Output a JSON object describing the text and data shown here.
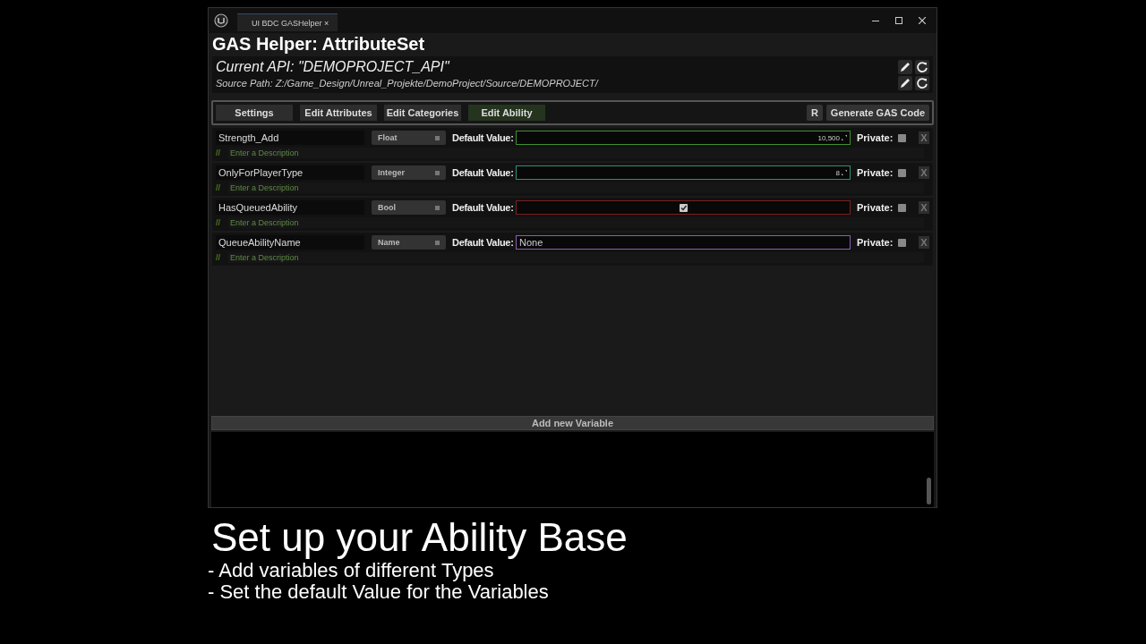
{
  "window": {
    "tab": "UI BDC GASHelper",
    "tab_close": "×"
  },
  "title": "GAS Helper: AttributeSet",
  "api": {
    "current": "Current API: \"DEMOPROJECT_API\"",
    "source_path": "Source Path: Z:/Game_Design/Unreal_Projekte/DemoProject/Source/DEMOPROJECT/"
  },
  "tabs": [
    {
      "label": "Settings",
      "selected": false
    },
    {
      "label": "Edit Attributes",
      "selected": false
    },
    {
      "label": "Edit Categories",
      "selected": false
    },
    {
      "label": "Edit Ability",
      "selected": true
    }
  ],
  "toolbar_buttons": [
    "R",
    "Generate GAS Code"
  ],
  "variables": [
    {
      "name": "Strength_Add",
      "type": "Float",
      "kind": "number",
      "color": "#3f8f2f",
      "default_label": "Default Value:",
      "value": "10,500",
      "private_label": "Private:",
      "private": false,
      "remove": "X",
      "description_mark": "//",
      "description_placeholder": "Enter a Description"
    },
    {
      "name": "OnlyForPlayerType",
      "type": "Integer",
      "kind": "number",
      "color": "#2f8f7a",
      "default_label": "Default Value:",
      "value": "8",
      "private_label": "Private:",
      "private": false,
      "remove": "X",
      "description_mark": "//",
      "description_placeholder": "Enter a Description"
    },
    {
      "name": "HasQueuedAbility",
      "type": "Bool",
      "kind": "bool",
      "color": "#7a1f1f",
      "default_label": "Default Value:",
      "checked": true,
      "private_label": "Private:",
      "private": false,
      "remove": "X",
      "description_mark": "//",
      "description_placeholder": "Enter a Description"
    },
    {
      "name": "QueueAbilityName",
      "type": "Name",
      "kind": "text",
      "color": "#8a5fb0",
      "default_label": "Default Value:",
      "value": "None",
      "private_label": "Private:",
      "private": false,
      "remove": "X",
      "description_mark": "//",
      "description_placeholder": "Enter a Description"
    }
  ],
  "add_button": "Add new Variable",
  "caption": {
    "heading": "Set up your Ability Base",
    "bullets": [
      "- Add variables of different Types",
      "- Set the default Value for the Variables"
    ]
  }
}
